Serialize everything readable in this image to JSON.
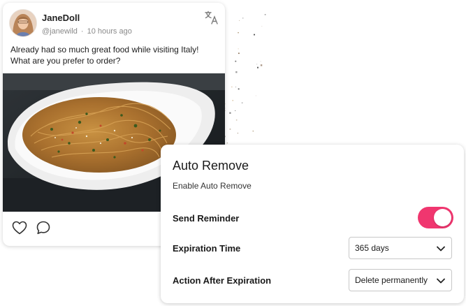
{
  "post": {
    "author_name": "JaneDoll",
    "handle": "@janewild",
    "time": "10 hours ago",
    "text_line1": "Already had so much great food while visiting Italy!",
    "text_line2": "What are you prefer to order?",
    "icons": {
      "translate": "translate-icon",
      "like": "heart-icon",
      "comment": "comment-icon"
    }
  },
  "settings": {
    "title": "Auto Remove",
    "subtitle": "Enable Auto Remove",
    "send_reminder_label": "Send Reminder",
    "send_reminder_on": true,
    "expiration_label": "Expiration Time",
    "expiration_value": "365 days",
    "action_label": "Action After Expiration",
    "action_value": "Delete permanently"
  },
  "colors": {
    "toggle_on": "#f0366f",
    "text": "#1a1a1a",
    "muted": "#8a8a8a"
  }
}
